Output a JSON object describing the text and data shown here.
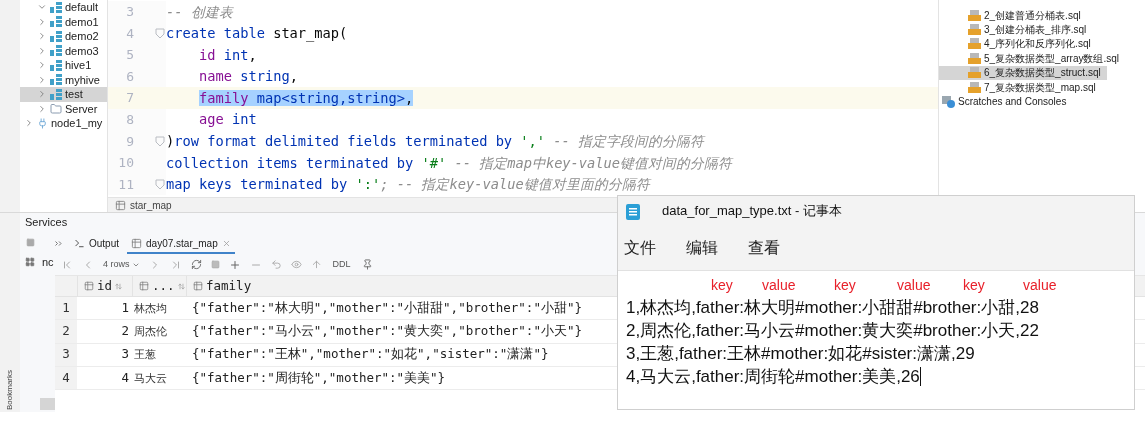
{
  "db_tree": {
    "items": [
      {
        "label": "default",
        "expanded": true,
        "selected": false,
        "kind": "schema"
      },
      {
        "label": "demo1",
        "expanded": false,
        "selected": false,
        "kind": "schema"
      },
      {
        "label": "demo2",
        "expanded": false,
        "selected": false,
        "kind": "schema"
      },
      {
        "label": "demo3",
        "expanded": false,
        "selected": false,
        "kind": "schema"
      },
      {
        "label": "hive1",
        "expanded": false,
        "selected": false,
        "kind": "schema"
      },
      {
        "label": "myhive",
        "expanded": false,
        "selected": false,
        "kind": "schema"
      },
      {
        "label": "test",
        "expanded": false,
        "selected": true,
        "kind": "schema"
      },
      {
        "label": "Server",
        "expanded": false,
        "selected": false,
        "kind": "folder"
      }
    ],
    "following_items": [
      {
        "label": "node1_my",
        "expanded": false,
        "selected": false,
        "kind": "connection"
      }
    ]
  },
  "editor": {
    "lines": [
      {
        "number": "3",
        "current": false,
        "selected": false,
        "fold": false,
        "indented": false,
        "tokens": [
          {
            "text": "-- 创建表",
            "kind": "comment"
          }
        ]
      },
      {
        "number": "4",
        "current": false,
        "selected": false,
        "fold": true,
        "indented": false,
        "tokens": [
          {
            "text": "create table ",
            "kind": "keyword"
          },
          {
            "text": "star_map(",
            "kind": "plain"
          }
        ]
      },
      {
        "number": "5",
        "current": false,
        "selected": false,
        "fold": false,
        "indented": true,
        "tokens": [
          {
            "text": "id",
            "kind": "field"
          },
          {
            "text": " int",
            "kind": "keyword"
          },
          {
            "text": ",",
            "kind": "plain"
          }
        ]
      },
      {
        "number": "6",
        "current": false,
        "selected": false,
        "fold": false,
        "indented": true,
        "tokens": [
          {
            "text": "name",
            "kind": "field"
          },
          {
            "text": " string",
            "kind": "keyword"
          },
          {
            "text": ",",
            "kind": "plain"
          }
        ]
      },
      {
        "number": "7",
        "current": true,
        "selected": true,
        "fold": false,
        "indented": true,
        "tokens": [
          {
            "text": "family",
            "kind": "field"
          },
          {
            "text": " map<string,string>",
            "kind": "keyword"
          },
          {
            "text": ",",
            "kind": "plain"
          }
        ]
      },
      {
        "number": "8",
        "current": false,
        "selected": false,
        "fold": false,
        "indented": true,
        "tokens": [
          {
            "text": "age",
            "kind": "field"
          },
          {
            "text": " int",
            "kind": "keyword"
          }
        ]
      },
      {
        "number": "9",
        "current": false,
        "selected": false,
        "fold": true,
        "indented": false,
        "tokens": [
          {
            "text": ")",
            "kind": "plain"
          },
          {
            "text": "row format delimited fields terminated by ",
            "kind": "keyword"
          },
          {
            "text": "','",
            "kind": "string"
          },
          {
            "text": " -- 指定字段间的分隔符",
            "kind": "comment"
          }
        ]
      },
      {
        "number": "10",
        "current": false,
        "selected": false,
        "fold": false,
        "indented": false,
        "tokens": [
          {
            "text": "collection items terminated by ",
            "kind": "keyword"
          },
          {
            "text": "'#'",
            "kind": "string"
          },
          {
            "text": " -- 指定map中key-value键值对间的分隔符",
            "kind": "comment"
          }
        ]
      },
      {
        "number": "11",
        "current": false,
        "selected": false,
        "fold": true,
        "indented": false,
        "tokens": [
          {
            "text": "map keys terminated by ",
            "kind": "keyword"
          },
          {
            "text": "':'",
            "kind": "string"
          },
          {
            "text": "; -- 指定key-value键值对里面的分隔符",
            "kind": "comment"
          }
        ]
      }
    ],
    "breadcrumb": "star_map"
  },
  "project_tree": {
    "items": [
      {
        "label": "2_创建普通分桶表.sql",
        "selected": false,
        "kind": "sql"
      },
      {
        "label": "3_创建分桶表_排序.sql",
        "selected": false,
        "kind": "sql"
      },
      {
        "label": "4_序列化和反序列化.sql",
        "selected": false,
        "kind": "sql"
      },
      {
        "label": "5_复杂数据类型_array数组.sql",
        "selected": false,
        "kind": "sql"
      },
      {
        "label": "6_复杂数据类型_struct.sql",
        "selected": true,
        "kind": "sql"
      },
      {
        "label": "7_复杂数据类型_map.sql",
        "selected": false,
        "kind": "sql"
      },
      {
        "label": "Scratches and Consoles",
        "selected": false,
        "kind": "scratches"
      }
    ]
  },
  "services": {
    "title": "Services",
    "node_label": "nc",
    "sidebar_label": "Bookmarks",
    "tabs": [
      {
        "label": "Output",
        "selected": false,
        "closable": false
      },
      {
        "label": "day07.star_map",
        "selected": true,
        "closable": true
      }
    ],
    "toolbar": {
      "row_count": "4 rows",
      "ddl": "DDL"
    },
    "table": {
      "columns": [
        "id",
        "...",
        "family"
      ],
      "rows": [
        {
          "number": "1",
          "id": "1",
          "name": "林杰均",
          "family": "{\"father\":\"林大明\",\"mother\":\"小甜甜\",\"brother\":\"小甜\"}"
        },
        {
          "number": "2",
          "id": "2",
          "name": "周杰伦",
          "family": "{\"father\":\"马小云\",\"mother\":\"黄大奕\",\"brother\":\"小天\"}"
        },
        {
          "number": "3",
          "id": "3",
          "name": "王葱",
          "family": "{\"father\":\"王林\",\"mother\":\"如花\",\"sister\":\"潇潇\"}"
        },
        {
          "number": "4",
          "id": "4",
          "name": "马大云",
          "family": "{\"father\":\"周街轮\",\"mother\":\"美美\"}"
        }
      ]
    }
  },
  "notepad": {
    "title": "data_for_map_type.txt - 记事本",
    "menu": [
      "文件",
      "编辑",
      "查看"
    ],
    "annotations": [
      "key",
      "value",
      "key",
      "value",
      "key",
      "value"
    ],
    "lines": [
      "1,林杰均,father:林大明#mother:小甜甜#brother:小甜,28",
      "2,周杰伦,father:马小云#mother:黄大奕#brother:小天,22",
      "3,王葱,father:王林#mother:如花#sister:潇潇,29",
      "4,马大云,father:周街轮#mother:美美,26"
    ],
    "caret": true
  }
}
